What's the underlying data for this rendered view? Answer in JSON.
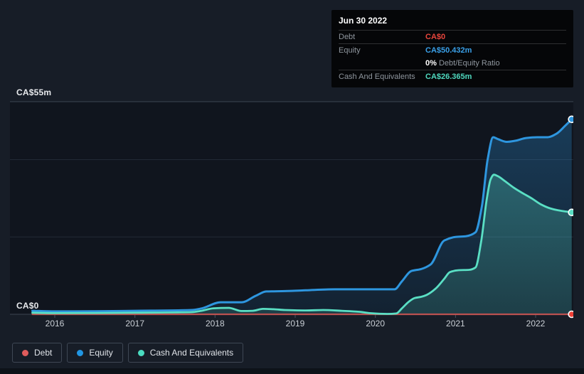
{
  "tooltip": {
    "date": "Jun 30 2022",
    "debt_label": "Debt",
    "debt_value": "CA$0",
    "equity_label": "Equity",
    "equity_value": "CA$50.432m",
    "ratio_value": "0%",
    "ratio_label": "Debt/Equity Ratio",
    "cash_label": "Cash And Equivalents",
    "cash_value": "CA$26.365m"
  },
  "legend": {
    "items": [
      {
        "label": "Debt",
        "color": "#e05c5c"
      },
      {
        "label": "Equity",
        "color": "#2196e3"
      },
      {
        "label": "Cash And Equivalents",
        "color": "#4adbc0"
      }
    ]
  },
  "colors": {
    "background": "#171d27",
    "debt_line": "#bb5150",
    "debt_dot": "#ee4037",
    "equity_line": "#2e96df",
    "equity_dot": "#2e96df",
    "cash_line": "#5adfc4",
    "cash_dot": "#5adfc4",
    "grid_major": "#3d4551",
    "grid_minor": "#222a36",
    "tick": "#4a525e"
  },
  "chart_data": {
    "type": "area",
    "title": "",
    "xlabel": "",
    "ylabel": "",
    "x_axis": {
      "ticks": [
        2016,
        2017,
        2018,
        2019,
        2020,
        2021,
        2022
      ],
      "labels": [
        "2016",
        "2017",
        "2018",
        "2019",
        "2020",
        "2021",
        "2022"
      ]
    },
    "y_axis": {
      "min": 0,
      "max": 55,
      "top_label": "CA$55m",
      "bottom_label": "CA$0",
      "gridlines": [
        0,
        20,
        40,
        55
      ]
    },
    "legend_position": "bottom-left",
    "unit": "CA$ millions",
    "series": [
      {
        "name": "Debt",
        "points": [
          [
            2015.72,
            0
          ],
          [
            2016.5,
            0
          ],
          [
            2017.5,
            0
          ],
          [
            2018.5,
            0
          ],
          [
            2019.5,
            0
          ],
          [
            2020.5,
            0
          ],
          [
            2021.5,
            0
          ],
          [
            2022.45,
            0
          ]
        ]
      },
      {
        "name": "Equity",
        "points": [
          [
            2015.72,
            0.9
          ],
          [
            2016.0,
            0.75
          ],
          [
            2016.5,
            0.8
          ],
          [
            2017.0,
            0.9
          ],
          [
            2017.71,
            1.1
          ],
          [
            2017.83,
            1.5
          ],
          [
            2018.07,
            3.1
          ],
          [
            2018.33,
            3.1
          ],
          [
            2018.51,
            4.8
          ],
          [
            2018.64,
            5.9
          ],
          [
            2018.87,
            6.0
          ],
          [
            2019.13,
            6.2
          ],
          [
            2019.49,
            6.45
          ],
          [
            2020.24,
            6.45
          ],
          [
            2020.33,
            8.5
          ],
          [
            2020.45,
            11.2
          ],
          [
            2020.57,
            11.7
          ],
          [
            2020.69,
            12.9
          ],
          [
            2020.86,
            19.1
          ],
          [
            2021.0,
            20.0
          ],
          [
            2021.13,
            20.2
          ],
          [
            2021.25,
            21.2
          ],
          [
            2021.33,
            28.0
          ],
          [
            2021.4,
            39.9
          ],
          [
            2021.47,
            45.8
          ],
          [
            2021.53,
            45.3
          ],
          [
            2021.64,
            44.6
          ],
          [
            2021.75,
            44.9
          ],
          [
            2021.88,
            45.6
          ],
          [
            2022.02,
            45.8
          ],
          [
            2022.15,
            45.8
          ],
          [
            2022.26,
            46.7
          ],
          [
            2022.37,
            48.8
          ],
          [
            2022.45,
            50.432
          ]
        ]
      },
      {
        "name": "Cash And Equivalents",
        "points": [
          [
            2015.72,
            0.4
          ],
          [
            2016.0,
            0.3
          ],
          [
            2017.0,
            0.4
          ],
          [
            2017.71,
            0.55
          ],
          [
            2017.83,
            0.9
          ],
          [
            2017.98,
            1.55
          ],
          [
            2018.17,
            1.65
          ],
          [
            2018.33,
            0.85
          ],
          [
            2018.47,
            0.9
          ],
          [
            2018.6,
            1.4
          ],
          [
            2018.73,
            1.3
          ],
          [
            2018.87,
            1.1
          ],
          [
            2019.13,
            1.0
          ],
          [
            2019.35,
            1.1
          ],
          [
            2019.58,
            0.9
          ],
          [
            2019.8,
            0.65
          ],
          [
            2019.93,
            0.3
          ],
          [
            2020.15,
            0.1
          ],
          [
            2020.26,
            0.2
          ],
          [
            2020.33,
            1.5
          ],
          [
            2020.42,
            3.3
          ],
          [
            2020.49,
            4.2
          ],
          [
            2020.57,
            4.5
          ],
          [
            2020.64,
            5.0
          ],
          [
            2020.75,
            6.6
          ],
          [
            2020.86,
            9.2
          ],
          [
            2020.93,
            10.9
          ],
          [
            2021.04,
            11.4
          ],
          [
            2021.17,
            11.5
          ],
          [
            2021.25,
            12.1
          ],
          [
            2021.32,
            18.8
          ],
          [
            2021.39,
            29.8
          ],
          [
            2021.44,
            35.0
          ],
          [
            2021.48,
            36.1
          ],
          [
            2021.53,
            35.7
          ],
          [
            2021.62,
            34.4
          ],
          [
            2021.73,
            32.7
          ],
          [
            2021.84,
            31.3
          ],
          [
            2021.95,
            30.0
          ],
          [
            2022.06,
            28.5
          ],
          [
            2022.18,
            27.4
          ],
          [
            2022.28,
            26.9
          ],
          [
            2022.45,
            26.365
          ]
        ]
      }
    ]
  }
}
